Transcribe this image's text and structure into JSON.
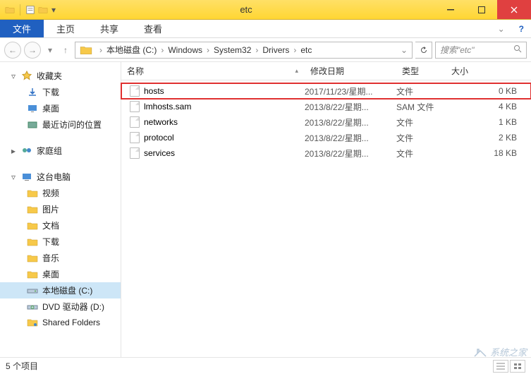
{
  "window": {
    "title": "etc",
    "min": "–",
    "max": "▢",
    "close": "✕"
  },
  "ribbon": {
    "file": "文件",
    "tabs": [
      "主页",
      "共享",
      "查看"
    ],
    "help": "?"
  },
  "address": {
    "segments": [
      "本地磁盘 (C:)",
      "Windows",
      "System32",
      "Drivers",
      "etc"
    ],
    "search_placeholder": "搜索\"etc\""
  },
  "sidebar": {
    "favorites": {
      "label": "收藏夹",
      "items": [
        {
          "icon": "download",
          "label": "下载"
        },
        {
          "icon": "desktop",
          "label": "桌面"
        },
        {
          "icon": "recent",
          "label": "最近访问的位置"
        }
      ]
    },
    "homegroup": {
      "label": "家庭组"
    },
    "thispc": {
      "label": "这台电脑",
      "items": [
        {
          "icon": "folder",
          "label": "视频"
        },
        {
          "icon": "folder",
          "label": "图片"
        },
        {
          "icon": "folder",
          "label": "文档"
        },
        {
          "icon": "folder",
          "label": "下载"
        },
        {
          "icon": "folder",
          "label": "音乐"
        },
        {
          "icon": "folder",
          "label": "桌面"
        },
        {
          "icon": "drive",
          "label": "本地磁盘 (C:)",
          "selected": true
        },
        {
          "icon": "dvd",
          "label": "DVD 驱动器 (D:)"
        },
        {
          "icon": "shared",
          "label": "Shared Folders"
        }
      ]
    }
  },
  "columns": {
    "name": "名称",
    "date": "修改日期",
    "type": "类型",
    "size": "大小"
  },
  "files": [
    {
      "name": "hosts",
      "date": "2017/11/23/星期...",
      "type": "文件",
      "size": "0 KB",
      "highlight": true
    },
    {
      "name": "lmhosts.sam",
      "date": "2013/8/22/星期...",
      "type": "SAM 文件",
      "size": "4 KB"
    },
    {
      "name": "networks",
      "date": "2013/8/22/星期...",
      "type": "文件",
      "size": "1 KB"
    },
    {
      "name": "protocol",
      "date": "2013/8/22/星期...",
      "type": "文件",
      "size": "2 KB"
    },
    {
      "name": "services",
      "date": "2013/8/22/星期...",
      "type": "文件",
      "size": "18 KB"
    }
  ],
  "statusbar": {
    "count": "5 个项目"
  },
  "watermark": "系统之家"
}
